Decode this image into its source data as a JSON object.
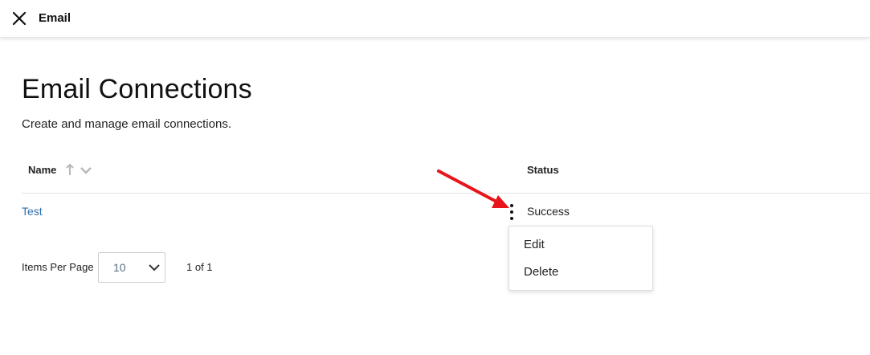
{
  "header": {
    "title": "Email",
    "close_icon": "close-icon"
  },
  "page": {
    "title": "Email Connections",
    "subtitle": "Create and manage email connections."
  },
  "table": {
    "columns": [
      "Name",
      "Status"
    ],
    "rows": [
      {
        "name": "Test",
        "status": "Success"
      }
    ]
  },
  "row_menu": {
    "items": [
      "Edit",
      "Delete"
    ]
  },
  "pagination": {
    "items_per_page_label": "Items Per Page",
    "items_per_page_value": "10",
    "page_info": "1 of 1"
  },
  "colors": {
    "link": "#2f6fa5",
    "annotation_arrow": "#e8141b",
    "sort_icon": "#b8b8b8"
  }
}
